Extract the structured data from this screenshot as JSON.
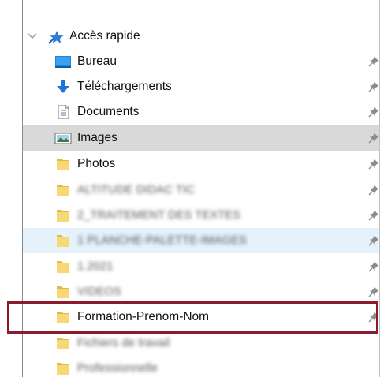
{
  "quick_access": {
    "label": "Accès rapide",
    "items": [
      {
        "label": "Bureau",
        "icon": "desktop-icon"
      },
      {
        "label": "Téléchargements",
        "icon": "download-arrow-icon"
      },
      {
        "label": "Documents",
        "icon": "document-icon"
      },
      {
        "label": "Images",
        "icon": "pictures-icon",
        "selected": true
      },
      {
        "label": "Photos",
        "icon": "folder-icon"
      },
      {
        "label": "ALTITUDE DIDAC TIC",
        "icon": "folder-icon",
        "blurred": true
      },
      {
        "label": "2_TRAITEMENT DES TEXTES",
        "icon": "folder-icon",
        "blurred": true
      },
      {
        "label": "1 PLANCHE-PALETTE-IMAGES",
        "icon": "folder-icon",
        "blurred": true,
        "hover": true
      },
      {
        "label": "1.2021",
        "icon": "folder-icon",
        "blurred": true
      },
      {
        "label": "VIDEOS",
        "icon": "folder-icon",
        "blurred": true
      },
      {
        "label": "Formation-Prenom-Nom",
        "icon": "folder-icon",
        "highlighted": true
      },
      {
        "label": "Fichiers de travail",
        "icon": "folder-icon",
        "blurred": true
      },
      {
        "label": "Professionnelle",
        "icon": "folder-icon",
        "blurred": true
      }
    ]
  },
  "colors": {
    "selection": "#d9d9d9",
    "hover": "#e5f1fb",
    "highlight_border": "#8b1a2b",
    "folder": "#f8d775",
    "folder_dark": "#e0b94a",
    "accent_blue": "#2f7bd9"
  }
}
